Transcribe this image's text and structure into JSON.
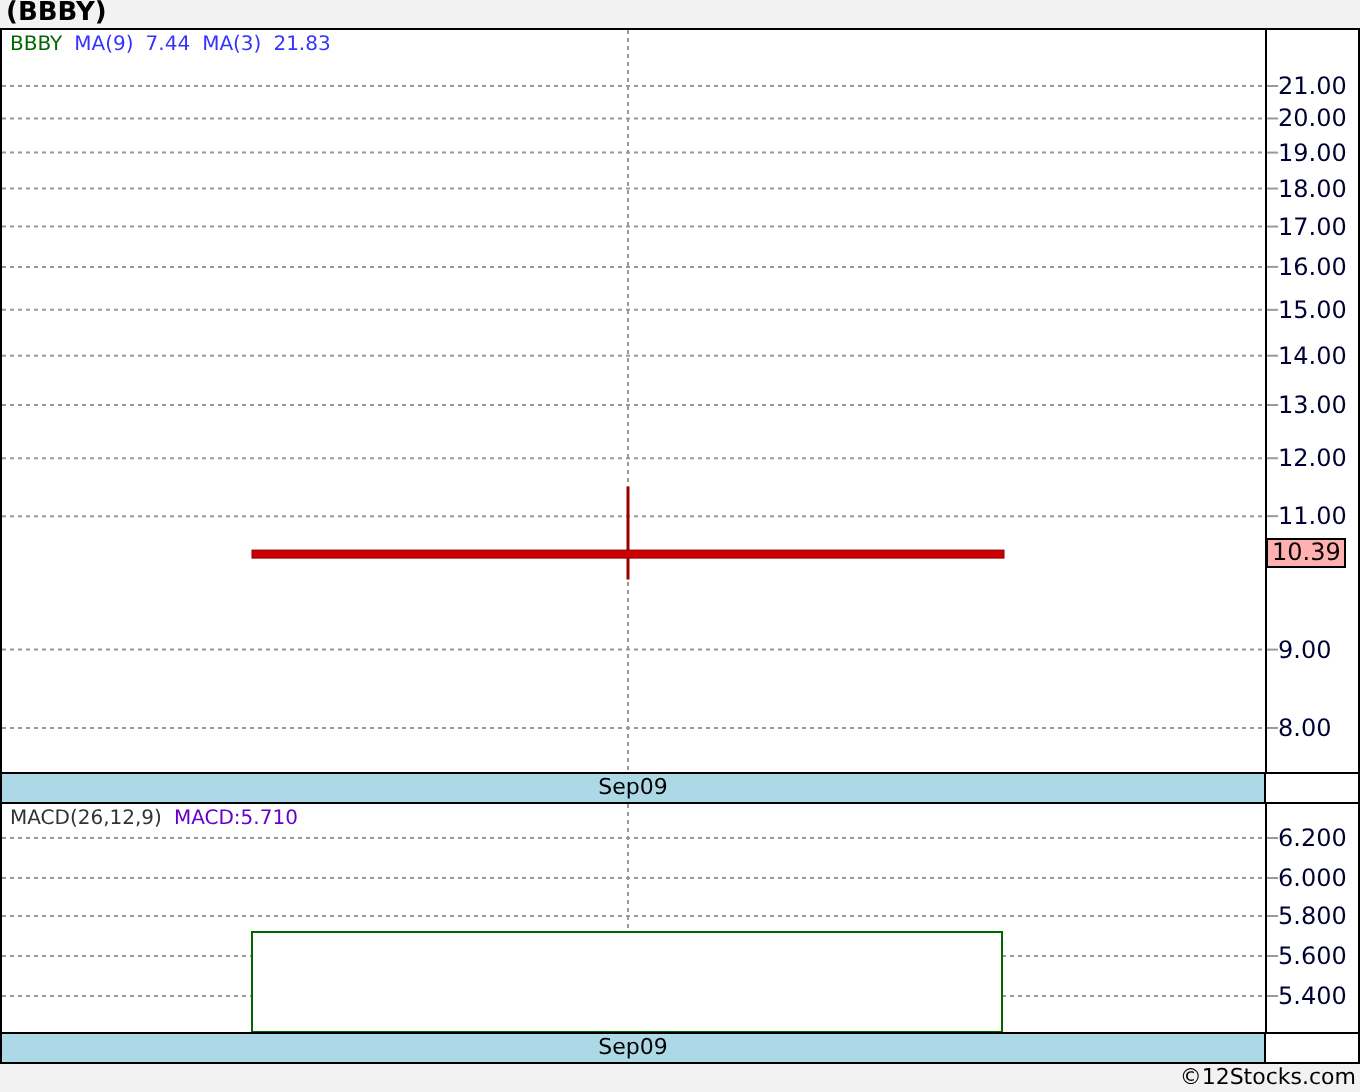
{
  "title": "(BBBY)",
  "price_panel": {
    "legend": {
      "symbol": "BBBY",
      "indicators": [
        {
          "label": "MA(9)",
          "value": "7.44"
        },
        {
          "label": "MA(3)",
          "value": "21.83"
        }
      ]
    },
    "last_price_label": "10.39",
    "axis_labels": [
      "21.00",
      "20.00",
      "19.00",
      "18.00",
      "17.00",
      "16.00",
      "15.00",
      "14.00",
      "13.00",
      "12.00",
      "11.00",
      "9.00",
      "8.00"
    ],
    "date_label": "Sep09"
  },
  "macd_panel": {
    "legend": {
      "name": "MACD(26,12,9)",
      "value": "MACD:5.710"
    },
    "axis_labels": [
      "6.200",
      "6.000",
      "5.800",
      "5.600",
      "5.400"
    ],
    "date_label": "Sep09"
  },
  "footer": "©12Stocks.com"
}
